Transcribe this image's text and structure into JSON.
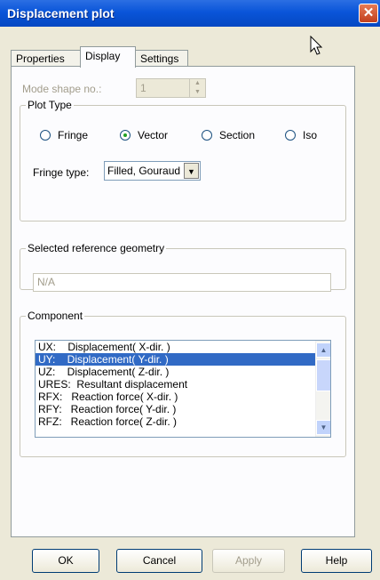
{
  "window": {
    "title": "Displacement plot",
    "close_glyph": "✕"
  },
  "tabs": [
    {
      "label": "Properties"
    },
    {
      "label": "Display"
    },
    {
      "label": "Settings"
    }
  ],
  "mode_shape": {
    "label": "Mode shape no.:",
    "value": "1"
  },
  "plot_type": {
    "legend": "Plot Type",
    "options": [
      {
        "label": "Fringe",
        "selected": false
      },
      {
        "label": "Vector",
        "selected": true
      },
      {
        "label": "Section",
        "selected": false
      },
      {
        "label": "Iso",
        "selected": false
      }
    ],
    "fringe_type_label": "Fringe type:",
    "fringe_type_value": "Filled, Gouraud"
  },
  "ref_geometry": {
    "legend": "Selected reference geometry",
    "value": "N/A"
  },
  "component": {
    "legend": "Component",
    "items": [
      {
        "label": "UX:    Displacement( X-dir. )",
        "selected": false
      },
      {
        "label": "UY:    Displacement( Y-dir. )",
        "selected": true
      },
      {
        "label": "UZ:    Displacement( Z-dir. )",
        "selected": false
      },
      {
        "label": "URES:  Resultant displacement",
        "selected": false
      },
      {
        "label": "RFX:   Reaction force( X-dir. )",
        "selected": false
      },
      {
        "label": "RFY:   Reaction force( Y-dir. )",
        "selected": false
      },
      {
        "label": "RFZ:   Reaction force( Z-dir. )",
        "selected": false
      }
    ]
  },
  "buttons": {
    "ok": "OK",
    "cancel": "Cancel",
    "apply": "Apply",
    "help": "Help"
  },
  "icons": {
    "close": "close-icon",
    "cursor": "mouse-pointer-icon",
    "scroll_up": "chevron-up-icon",
    "scroll_down": "chevron-down-icon",
    "dropdown": "chevron-down-icon"
  },
  "colors": {
    "titlebar": "#0a55d9",
    "selection": "#316ac5",
    "dialog_bg": "#ece9d8"
  }
}
